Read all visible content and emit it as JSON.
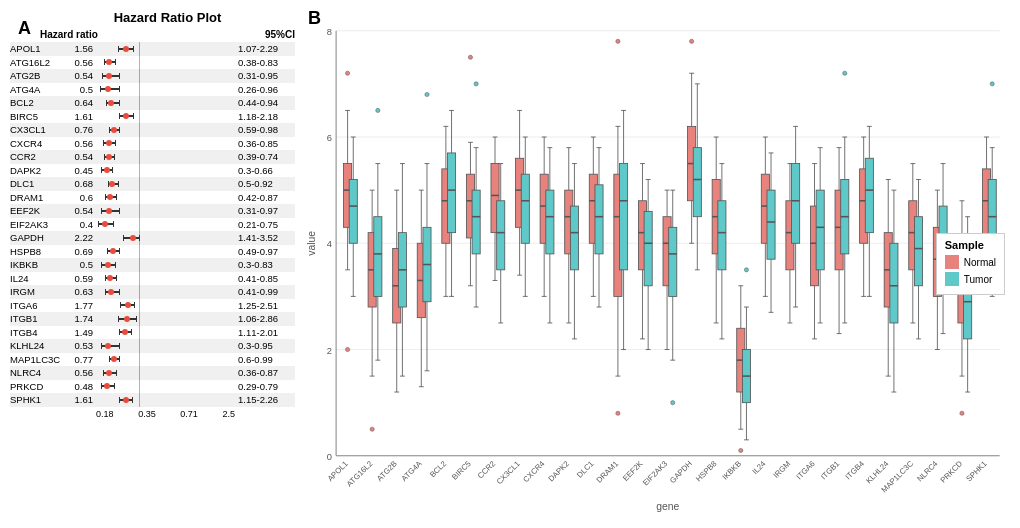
{
  "panelA": {
    "label": "A",
    "title": "Hazard Ratio Plot",
    "col_hazard": "Hazard ratio",
    "col_ci": "95%CI",
    "x_axis_labels": [
      "0.18",
      "0.35",
      "0.71",
      "2.5"
    ],
    "rows": [
      {
        "gene": "APOL1",
        "hr": "1.56",
        "ci": "1.07-2.29",
        "point": 0.72,
        "lo": 0.55,
        "hi": 0.87,
        "highlighted": false
      },
      {
        "gene": "ATG16L2",
        "hr": "0.56",
        "ci": "0.38-0.83",
        "point": 0.38,
        "lo": 0.27,
        "hi": 0.5,
        "highlighted": true
      },
      {
        "gene": "ATG2B",
        "hr": "0.54",
        "ci": "0.31-0.95",
        "point": 0.37,
        "lo": 0.22,
        "hi": 0.58,
        "highlighted": false
      },
      {
        "gene": "ATG4A",
        "hr": "0.5",
        "ci": "0.26-0.96",
        "point": 0.35,
        "lo": 0.18,
        "hi": 0.58,
        "highlighted": true
      },
      {
        "gene": "BCL2",
        "hr": "0.64",
        "ci": "0.44-0.94",
        "point": 0.42,
        "lo": 0.3,
        "hi": 0.57,
        "highlighted": false
      },
      {
        "gene": "BIRC5",
        "hr": "1.61",
        "ci": "1.18-2.18",
        "point": 0.73,
        "lo": 0.59,
        "hi": 0.87,
        "highlighted": true
      },
      {
        "gene": "CX3CL1",
        "hr": "0.76",
        "ci": "0.59-0.98",
        "point": 0.47,
        "lo": 0.38,
        "hi": 0.57,
        "highlighted": false
      },
      {
        "gene": "CXCR4",
        "hr": "0.56",
        "ci": "0.36-0.85",
        "point": 0.38,
        "lo": 0.25,
        "hi": 0.5,
        "highlighted": true
      },
      {
        "gene": "CCR2",
        "hr": "0.54",
        "ci": "0.39-0.74",
        "point": 0.37,
        "lo": 0.27,
        "hi": 0.48,
        "highlighted": false
      },
      {
        "gene": "DAPK2",
        "hr": "0.45",
        "ci": "0.3-0.66",
        "point": 0.32,
        "lo": 0.21,
        "hi": 0.44,
        "highlighted": true
      },
      {
        "gene": "DLC1",
        "hr": "0.68",
        "ci": "0.5-0.92",
        "point": 0.44,
        "lo": 0.34,
        "hi": 0.55,
        "highlighted": false
      },
      {
        "gene": "DRAM1",
        "hr": "0.6",
        "ci": "0.42-0.87",
        "point": 0.4,
        "lo": 0.29,
        "hi": 0.52,
        "highlighted": true
      },
      {
        "gene": "EEF2K",
        "hr": "0.54",
        "ci": "0.31-0.97",
        "point": 0.37,
        "lo": 0.21,
        "hi": 0.58,
        "highlighted": false
      },
      {
        "gene": "EIF2AK3",
        "hr": "0.4",
        "ci": "0.21-0.75",
        "point": 0.29,
        "lo": 0.15,
        "hi": 0.46,
        "highlighted": true
      },
      {
        "gene": "GAPDH",
        "hr": "2.22",
        "ci": "1.41-3.52",
        "point": 0.88,
        "lo": 0.67,
        "hi": 1.0,
        "highlighted": false
      },
      {
        "gene": "HSPB8",
        "hr": "0.69",
        "ci": "0.49-0.97",
        "point": 0.45,
        "lo": 0.33,
        "hi": 0.57,
        "highlighted": true
      },
      {
        "gene": "IKBKB",
        "hr": "0.5",
        "ci": "0.3-0.83",
        "point": 0.35,
        "lo": 0.21,
        "hi": 0.5,
        "highlighted": false
      },
      {
        "gene": "IL24",
        "hr": "0.59",
        "ci": "0.41-0.85",
        "point": 0.39,
        "lo": 0.28,
        "hi": 0.51,
        "highlighted": true
      },
      {
        "gene": "IRGM",
        "hr": "0.63",
        "ci": "0.41-0.99",
        "point": 0.42,
        "lo": 0.28,
        "hi": 0.58,
        "highlighted": false
      },
      {
        "gene": "ITGA6",
        "hr": "1.77",
        "ci": "1.25-2.51",
        "point": 0.76,
        "lo": 0.6,
        "hi": 0.9,
        "highlighted": true
      },
      {
        "gene": "ITGB1",
        "hr": "1.74",
        "ci": "1.06-2.86",
        "point": 0.75,
        "lo": 0.56,
        "hi": 0.94,
        "highlighted": false
      },
      {
        "gene": "ITGB4",
        "hr": "1.49",
        "ci": "1.11-2.01",
        "point": 0.7,
        "lo": 0.57,
        "hi": 0.83,
        "highlighted": true
      },
      {
        "gene": "KLHL24",
        "hr": "0.53",
        "ci": "0.3-0.95",
        "point": 0.36,
        "lo": 0.21,
        "hi": 0.58,
        "highlighted": false
      },
      {
        "gene": "MAP1LC3C",
        "hr": "0.77",
        "ci": "0.6-0.99",
        "point": 0.47,
        "lo": 0.38,
        "hi": 0.57,
        "highlighted": true
      },
      {
        "gene": "NLRC4",
        "hr": "0.56",
        "ci": "0.36-0.87",
        "point": 0.38,
        "lo": 0.25,
        "hi": 0.52,
        "highlighted": false
      },
      {
        "gene": "PRKCD",
        "hr": "0.48",
        "ci": "0.29-0.79",
        "point": 0.33,
        "lo": 0.2,
        "hi": 0.48,
        "highlighted": true
      },
      {
        "gene": "SPHK1",
        "hr": "1.61",
        "ci": "1.15-2.26",
        "point": 0.73,
        "lo": 0.59,
        "hi": 0.86,
        "highlighted": false
      }
    ]
  },
  "panelB": {
    "label": "B",
    "y_axis_label": "value",
    "x_axis_label": "gene",
    "legend": {
      "title": "Sample",
      "items": [
        {
          "label": "Normal",
          "color": "#E8827C"
        },
        {
          "label": "Tumor",
          "color": "#5FC8C8"
        }
      ]
    },
    "genes": [
      "APOL1",
      "ATG16L2",
      "ATG2B",
      "ATG4A",
      "BCL2",
      "BIRC5",
      "CCR2",
      "CX3CL1",
      "CXC R4",
      "DAPK2",
      "DLC1",
      "DRAM1",
      "EEF2K",
      "EIF2AK3",
      "GAPDH",
      "HSPB8",
      "IKBKB",
      "IL24",
      "IRGM",
      "ITGA6",
      "ITGB1",
      "ITGB4",
      "KLHL24",
      "MAP1LC3C",
      "NLRC4",
      "PRKCD",
      "SPHK1"
    ]
  }
}
